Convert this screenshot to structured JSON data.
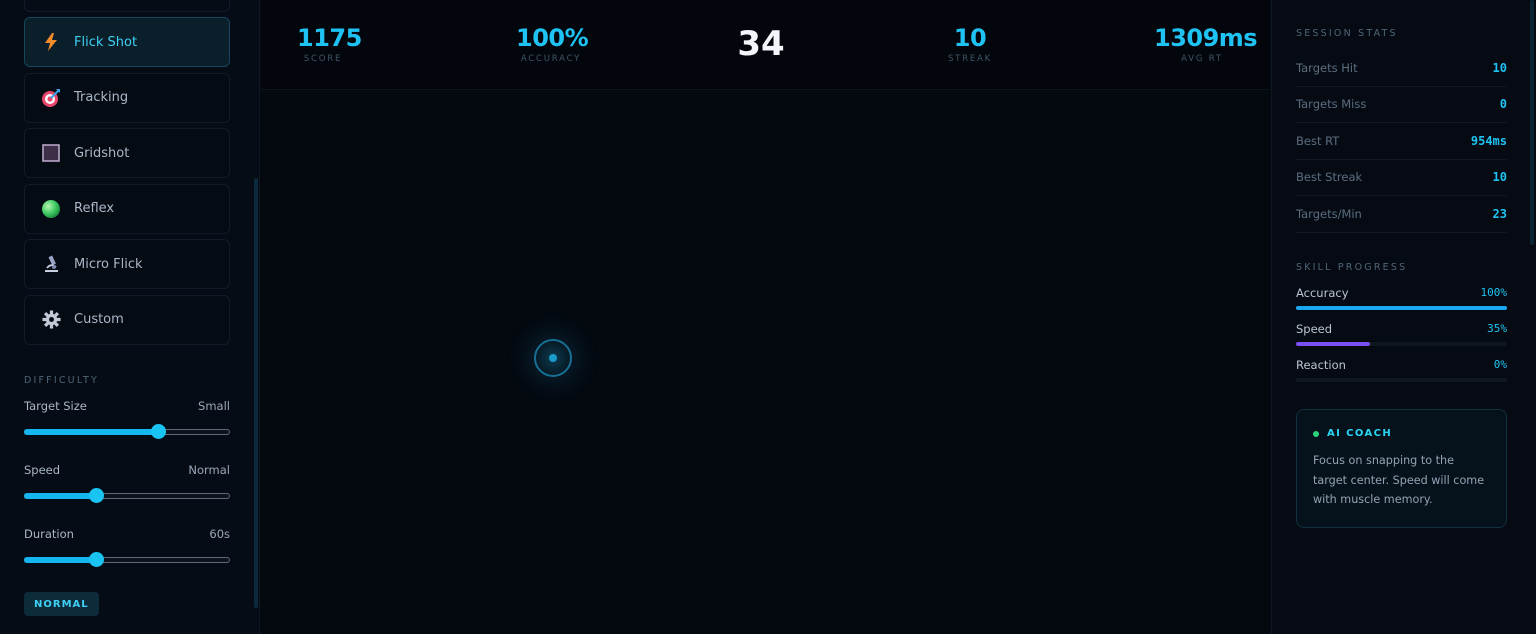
{
  "modes": [
    {
      "label": "Flick Shot",
      "icon": "lightning-icon",
      "active": true
    },
    {
      "label": "Tracking",
      "icon": "target-dart-icon",
      "active": false
    },
    {
      "label": "Gridshot",
      "icon": "grid-square-icon",
      "active": false
    },
    {
      "label": "Reflex",
      "icon": "green-orb-icon",
      "active": false
    },
    {
      "label": "Micro Flick",
      "icon": "microscope-icon",
      "active": false
    },
    {
      "label": "Custom",
      "icon": "gear-icon",
      "active": false
    }
  ],
  "difficulty": {
    "section_label": "DIFFICULTY",
    "target_size": {
      "label": "Target Size",
      "value": "Small",
      "level": 0.65
    },
    "speed": {
      "label": "Speed",
      "value": "Normal",
      "level": 0.35
    },
    "duration": {
      "label": "Duration",
      "value": "60s",
      "level": 0.35
    },
    "badge": "NORMAL"
  },
  "hud": {
    "score": {
      "value": "1175",
      "label": "SCORE"
    },
    "accuracy": {
      "value": "100%",
      "label": "ACCURACY"
    },
    "timer": "34",
    "streak": {
      "value": "10",
      "label": "STREAK"
    },
    "avg_rt": {
      "value": "1309ms",
      "label": "AVG RT"
    }
  },
  "session_stats": {
    "title": "SESSION STATS",
    "rows": [
      {
        "label": "Targets Hit",
        "value": "10"
      },
      {
        "label": "Targets Miss",
        "value": "0"
      },
      {
        "label": "Best RT",
        "value": "954ms"
      },
      {
        "label": "Best Streak",
        "value": "10"
      },
      {
        "label": "Targets/Min",
        "value": "23"
      }
    ]
  },
  "skill_progress": {
    "title": "SKILL PROGRESS",
    "items": [
      {
        "label": "Accuracy",
        "value": "100%",
        "level": 1.0
      },
      {
        "label": "Speed",
        "value": "35%",
        "level": 0.35
      },
      {
        "label": "Reaction",
        "value": "0%",
        "level": 0.0
      }
    ]
  },
  "coach": {
    "title": "AI COACH",
    "text": "Focus on snapping to the target center. Speed will come with muscle memory."
  },
  "colors": {
    "accent": "#1fc3f3",
    "accuracy_bar": "#1aa6f0",
    "speed_bar": "#7a4ef0",
    "coach_dot": "#2bd37a"
  }
}
